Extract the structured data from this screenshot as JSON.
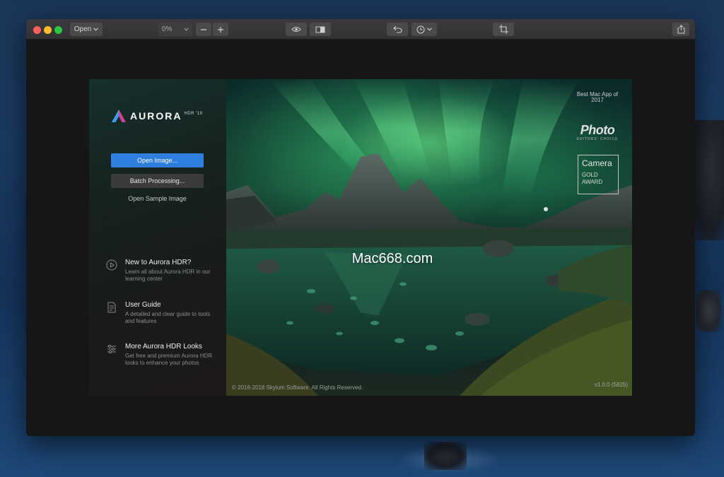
{
  "toolbar": {
    "open_label": "Open",
    "zoom_value": "0%",
    "icons": [
      "chevron-down-icon",
      "minus-icon",
      "plus-icon",
      "eye-icon",
      "compare-icon",
      "undo-icon",
      "history-icon",
      "crop-icon",
      "share-icon"
    ]
  },
  "sidebar": {
    "logo_name": "AURORA",
    "logo_suffix": "HDR '19",
    "open_image_label": "Open Image...",
    "batch_label": "Batch Processing...",
    "sample_label": "Open Sample Image",
    "help_items": [
      {
        "icon": "play-icon",
        "title": "New to Aurora HDR?",
        "desc": "Learn all about Aurora HDR in our learning center"
      },
      {
        "icon": "document-icon",
        "title": "User Guide",
        "desc": "A detailed and clear guide to tools and features"
      },
      {
        "icon": "sliders-icon",
        "title": "More Aurora HDR Looks",
        "desc": "Get free and premium Aurora HDR looks to enhance your photos"
      }
    ]
  },
  "hero": {
    "award_best": "Best Mac App of 2017",
    "award_photo": "Photo",
    "award_photo_sub": "EDITORS' CHOICE",
    "award_camera": "Camera",
    "award_gold": "GOLD AWARD",
    "watermark": "Mac668.com",
    "copyright": "© 2016-2018 Skylum Software. All Rights Reserved.",
    "version": "v1.0.0 (5825)"
  },
  "colors": {
    "primary_button": "#2f7fe0",
    "window_bg": "#161616",
    "close": "#ff5f57",
    "minimize": "#febc2e",
    "maximize": "#28c840"
  }
}
